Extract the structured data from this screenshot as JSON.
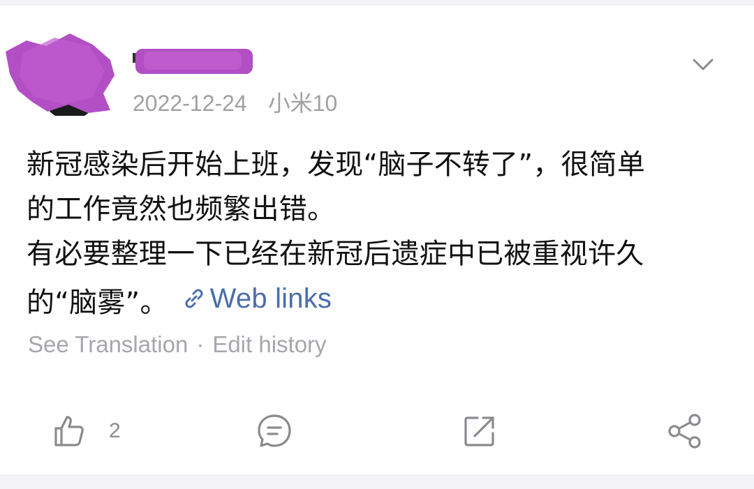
{
  "post": {
    "date": "2022-12-24",
    "device": "小米10",
    "text_lines": [
      "新冠感染后开始上班，发现“脑子不转了”，很简单",
      "的工作竟然也频繁出错。",
      "有必要整理一下已经在新冠后遗症中已被重视许久",
      "的“脑雾”。"
    ],
    "web_link_label": "Web links",
    "see_translation": "See Translation",
    "separator": "·",
    "edit_history": "Edit history"
  },
  "actions": {
    "like_count": "2"
  },
  "icons": {
    "more": "chevron-down-icon",
    "link": "link-icon",
    "like": "thumbs-up-icon",
    "comment": "comment-icon",
    "repost": "repost-icon",
    "share": "share-icon"
  },
  "colors": {
    "background": "#f3f3f5",
    "card": "#ffffff",
    "text": "#111111",
    "meta": "#a0a0a5",
    "link": "#4a6ea9",
    "icon": "#8a8a8f",
    "redaction": "#b050c0"
  }
}
